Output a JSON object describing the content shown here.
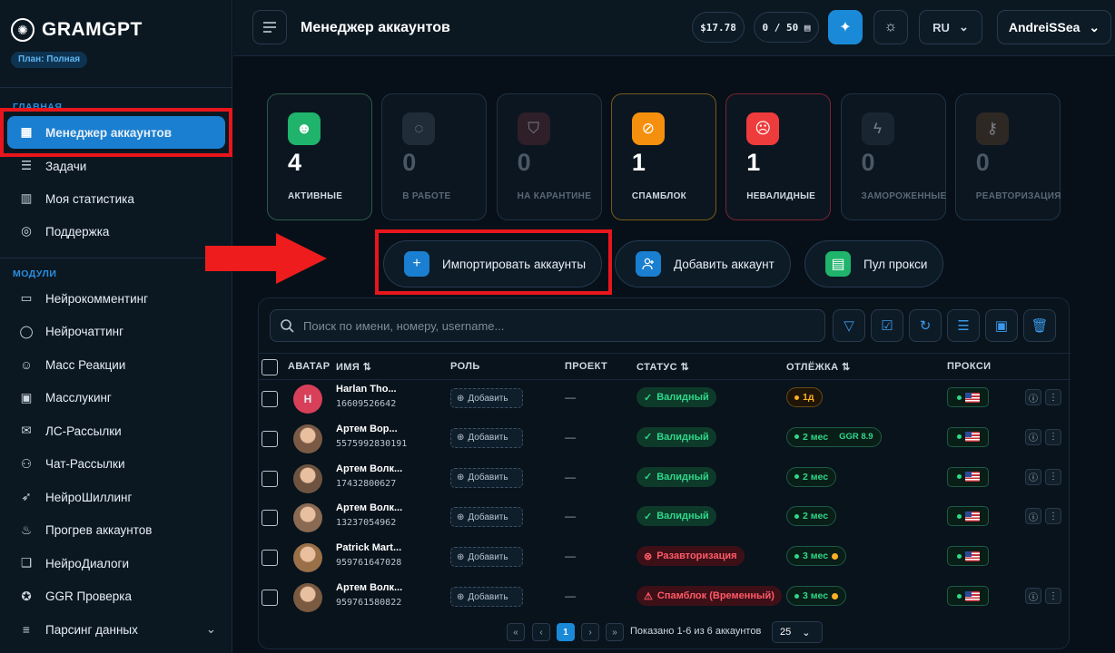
{
  "brand": {
    "name": "GRAMGPT",
    "plan": "План: Полная"
  },
  "sidebar": {
    "section_main": "ГЛАВНАЯ",
    "main_items": [
      {
        "label": "Менеджер аккаунтов",
        "icon": "grid-icon",
        "active": true
      },
      {
        "label": "Задачи",
        "icon": "list-icon"
      },
      {
        "label": "Моя статистика",
        "icon": "chart-icon"
      },
      {
        "label": "Поддержка",
        "icon": "lifebuoy-icon"
      }
    ],
    "section_modules": "МОДУЛИ",
    "module_items": [
      {
        "label": "Нейрокомментинг",
        "icon": "comment-icon"
      },
      {
        "label": "Нейрочаттинг",
        "icon": "chat-icon"
      },
      {
        "label": "Масс Реакции",
        "icon": "smile-icon"
      },
      {
        "label": "Масслукинг",
        "icon": "monitor-icon"
      },
      {
        "label": "ЛС-Рассылки",
        "icon": "send-icon"
      },
      {
        "label": "Чат-Рассылки",
        "icon": "users-icon"
      },
      {
        "label": "НейроШиллинг",
        "icon": "rocket-icon"
      },
      {
        "label": "Прогрев аккаунтов",
        "icon": "flame-icon"
      },
      {
        "label": "НейроДиалоги",
        "icon": "dialog-icon"
      },
      {
        "label": "GGR Проверка",
        "icon": "star-icon"
      },
      {
        "label": "Парсинг данных",
        "icon": "database-icon"
      }
    ]
  },
  "header": {
    "title": "Менеджер аккаунтов",
    "balance": "$17.78",
    "accounts_quota": "0 / 50",
    "language": "RU",
    "username": "AndreiSSea"
  },
  "stats": [
    {
      "value": "4",
      "label": "АКТИВНЫЕ",
      "color": "#1fb36b",
      "icon": "user-icon"
    },
    {
      "value": "0",
      "label": "В РАБОТЕ",
      "color": "#3a4a58",
      "icon": "spinner-icon"
    },
    {
      "value": "0",
      "label": "НА КАРАНТИНЕ",
      "color": "#5a2a36",
      "icon": "shield-icon"
    },
    {
      "value": "1",
      "label": "СПАМБЛОК",
      "color": "#f5900e",
      "icon": "ban-icon"
    },
    {
      "value": "1",
      "label": "НЕВАЛИДНЫЕ",
      "color": "#ee3b3b",
      "icon": "user-x-icon"
    },
    {
      "value": "0",
      "label": "ЗАМОРОЖЕННЫЕ",
      "color": "#2c3a48",
      "icon": "bolt-icon"
    },
    {
      "value": "0",
      "label": "РЕАВТОРИЗАЦИЯ",
      "color": "#5a3f2a",
      "icon": "key-icon"
    }
  ],
  "actions": {
    "import": "Импортировать аккаунты",
    "add": "Добавить аккаунт",
    "proxy": "Пул прокси"
  },
  "search": {
    "placeholder": "Поиск по имени, номеру, username..."
  },
  "table": {
    "headers": {
      "avatar": "АВАТАР",
      "name": "ИМЯ",
      "role": "РОЛЬ",
      "project": "ПРОЕКТ",
      "status": "СТАТУС",
      "otlezhka": "ОТЛЁЖКА",
      "proxy": "ПРОКСИ"
    },
    "add_role": "Добавить",
    "rows": [
      {
        "name": "Harlan Tho...",
        "phone": "16609526642",
        "project": "—",
        "status": "Валидный",
        "status_type": "ok",
        "otlezhka": "1д",
        "otlezhka_type": "warm",
        "ggr": "",
        "initial": "H",
        "avatar_color": "#d8405a",
        "extra": true
      },
      {
        "name": "Артем Вор...",
        "phone": "5575992830191",
        "project": "—",
        "status": "Валидный",
        "status_type": "ok",
        "otlezhka": "2 мес",
        "otlezhka_type": "ok",
        "ggr": "GGR 8.9",
        "initial": "",
        "avatar_color": "#7a5a44",
        "extra": true
      },
      {
        "name": "Артем Волк...",
        "phone": "17432800627",
        "project": "—",
        "status": "Валидный",
        "status_type": "ok",
        "otlezhka": "2 мес",
        "otlezhka_type": "ok",
        "ggr": "",
        "initial": "",
        "avatar_color": "#6e5440",
        "extra": true
      },
      {
        "name": "Артем Волк...",
        "phone": "13237054962",
        "project": "—",
        "status": "Валидный",
        "status_type": "ok",
        "otlezhka": "2 мес",
        "otlezhka_type": "ok",
        "ggr": "",
        "initial": "",
        "avatar_color": "#8a6a52",
        "extra": true
      },
      {
        "name": "Patrick Mart...",
        "phone": "959761647028",
        "project": "—",
        "status": "Разавторизация",
        "status_type": "bad",
        "otlezhka": "3 мес",
        "otlezhka_type": "ok",
        "ggr": "",
        "initial": "",
        "avatar_color": "#9a7048",
        "extra": false
      },
      {
        "name": "Артем Волк...",
        "phone": "959761580822",
        "project": "—",
        "status": "Спамблок (Временный)",
        "status_type": "bad",
        "otlezhka": "3 мес",
        "otlezhka_type": "ok",
        "ggr": "",
        "initial": "",
        "avatar_color": "#7a5a40",
        "extra": true
      }
    ]
  },
  "pagination": {
    "page": "1",
    "info": "Показано 1-6 из 6 аккаунтов",
    "per_page": "25"
  }
}
